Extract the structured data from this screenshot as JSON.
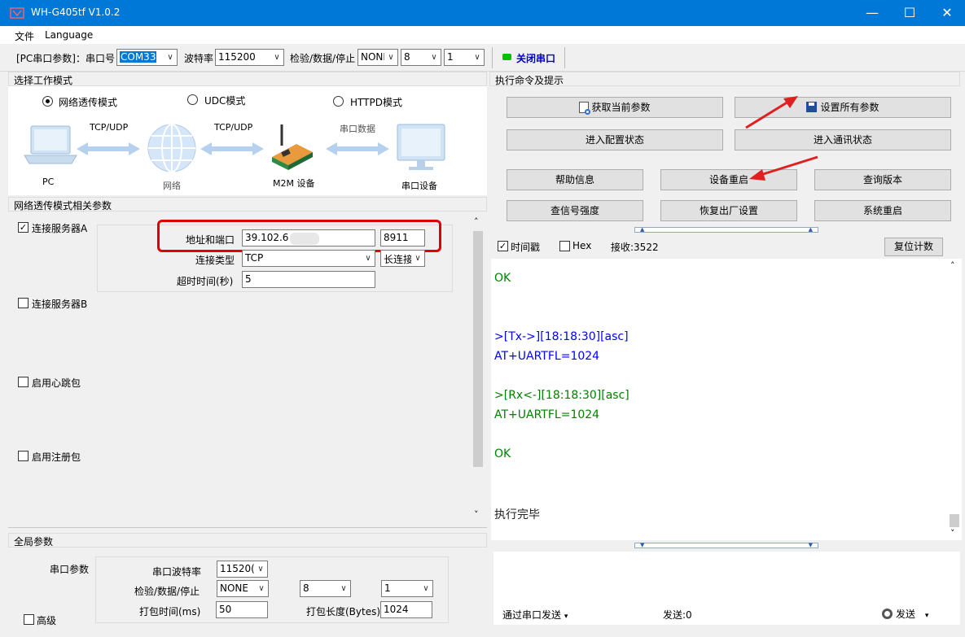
{
  "window": {
    "title": "WH-G405tf V1.0.2",
    "controls": {
      "minimize": "—",
      "maximize": "☐",
      "close": "✕"
    }
  },
  "menu": {
    "file": "文件",
    "language": "Language"
  },
  "toolbar": {
    "pc_port_label": "[PC串口参数]：串口号",
    "port_value": "COM33",
    "baud_label": "波特率",
    "baud_value": "115200",
    "check_label": "检验/数据/停止",
    "parity_value": "NONI",
    "databits_value": "8",
    "stopbits_value": "1",
    "close_port_label": "关闭串口",
    "status_color": "#00c000"
  },
  "left": {
    "mode_header": "选择工作模式",
    "modes": [
      {
        "label": "网络透传模式",
        "selected": true
      },
      {
        "label": "UDC模式",
        "selected": false
      },
      {
        "label": "HTTPD模式",
        "selected": false
      }
    ],
    "diagram": {
      "pc": "PC",
      "tcp1": "TCP/UDP",
      "network": "网络",
      "tcp2": "TCP/UDP",
      "m2m": "M2M 设备",
      "serial_data": "串口数据",
      "serial_device": "串口设备"
    },
    "net_header": "网络透传模式相关参数",
    "server_a": {
      "label": "连接服务器A",
      "checked": true,
      "addr_label": "地址和端口",
      "addr_value": "39.102.6",
      "port_value": "8911",
      "conn_type_label": "连接类型",
      "conn_type_value": "TCP",
      "conn_mode_value": "长连接",
      "timeout_label": "超时时间(秒)",
      "timeout_value": "5"
    },
    "server_b": {
      "label": "连接服务器B",
      "checked": false
    },
    "heartbeat": {
      "label": "启用心跳包",
      "checked": false
    },
    "register": {
      "label": "启用注册包",
      "checked": false
    }
  },
  "global": {
    "header": "全局参数",
    "serial_params_label": "串口参数",
    "advanced_label": "高级",
    "baud_label": "串口波特率",
    "baud_value": "11520(",
    "check_label": "检验/数据/停止",
    "parity_value": "NONE",
    "databits_value": "8",
    "stopbits_value": "1",
    "pack_time_label": "打包时间(ms)",
    "pack_time_value": "50",
    "pack_len_label": "打包长度(Bytes)",
    "pack_len_value": "1024"
  },
  "right": {
    "header": "执行命令及提示",
    "buttons": {
      "get_params": "获取当前参数",
      "set_all": "设置所有参数",
      "enter_config": "进入配置状态",
      "enter_comm": "进入通讯状态",
      "help": "帮助信息",
      "restart_device": "设备重启",
      "query_version": "查询版本",
      "signal": "查信号强度",
      "factory_reset": "恢复出厂设置",
      "system_restart": "系统重启"
    },
    "timestamp_label": "时间戳",
    "timestamp_checked": true,
    "hex_label": "Hex",
    "hex_checked": false,
    "recv_label": "接收:3522",
    "reset_count": "复位计数",
    "terminal": {
      "line1": "OK",
      "line2": ">[Tx->][18:18:30][asc]",
      "line3": "AT+UARTFL=1024",
      "line4": ">[Rx<-][18:18:30][asc]",
      "line5": "AT+UARTFL=1024",
      "line6": "OK",
      "line7": "执行完毕"
    },
    "send_via_serial": "通过串口发送",
    "send_count": "发送:0",
    "send_button": "发送"
  }
}
